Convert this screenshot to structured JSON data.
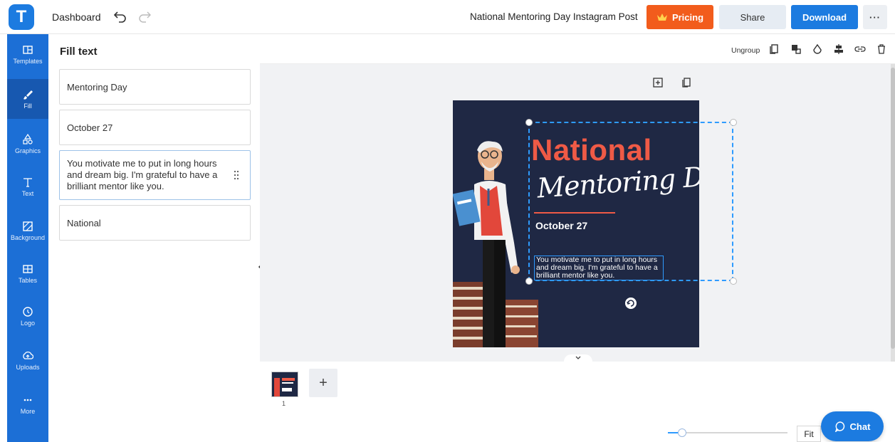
{
  "topbar": {
    "logo_letter": "T",
    "dashboard_label": "Dashboard",
    "document_title": "National Mentoring Day Instagram Post",
    "pricing_label": "Pricing",
    "share_label": "Share",
    "download_label": "Download",
    "more_label": "···"
  },
  "rail": {
    "items": [
      {
        "label": "Templates",
        "icon": "templates-icon"
      },
      {
        "label": "Fill",
        "icon": "brush-icon"
      },
      {
        "label": "Graphics",
        "icon": "shapes-icon"
      },
      {
        "label": "Text",
        "icon": "text-icon"
      },
      {
        "label": "Background",
        "icon": "background-icon"
      },
      {
        "label": "Tables",
        "icon": "table-icon"
      },
      {
        "label": "Logo",
        "icon": "logo-icon"
      },
      {
        "label": "Uploads",
        "icon": "upload-icon"
      },
      {
        "label": "More",
        "icon": "more-icon"
      }
    ]
  },
  "panel": {
    "title": "Fill text",
    "fields": [
      "Mentoring Day",
      "October 27",
      "You motivate me to put in long hours and dream big. I'm grateful to have a brilliant mentor like you.",
      "National"
    ]
  },
  "toolbar": {
    "ungroup_label": "Ungroup"
  },
  "artboard": {
    "national": "National",
    "mentoring": "Mentoring Day",
    "date": "October 27",
    "quote": "You motivate me to put in long hours and dream big. I'm grateful to have a brilliant mentor like you."
  },
  "pages": {
    "page_number": "1",
    "add_label": "+"
  },
  "zoom": {
    "fit_label": "Fit"
  },
  "chat": {
    "label": "Chat"
  },
  "colors": {
    "brand_blue": "#1c7be0",
    "pricing_orange": "#f25c1c",
    "artboard_navy": "#1f2844",
    "accent_red": "#ef5a46",
    "selection_blue": "#2e9bff"
  }
}
